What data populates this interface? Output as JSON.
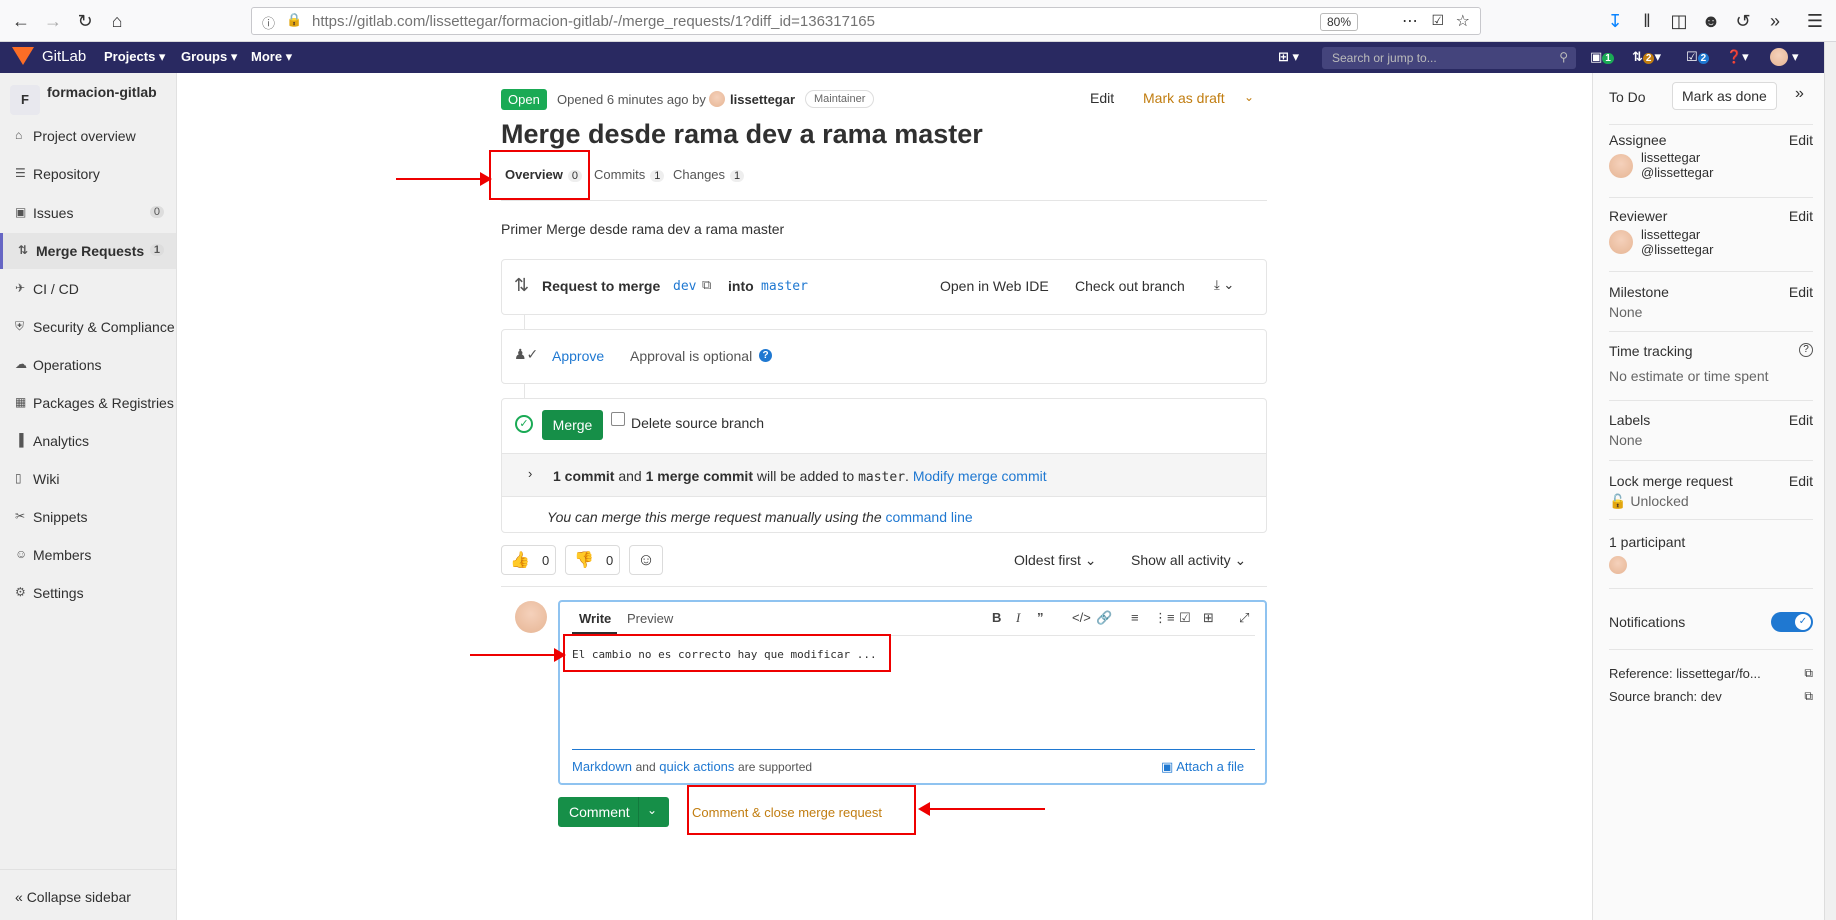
{
  "browser": {
    "url": "https://gitlab.com/lissettegar/formacion-gitlab/-/merge_requests/1?diff_id=136317165",
    "zoom": "80%"
  },
  "navbar": {
    "brand": "GitLab",
    "projects": "Projects",
    "groups": "Groups",
    "more": "More",
    "search_placeholder": "Search or jump to...",
    "badge_issues": "1",
    "badge_mr": "2",
    "badge_todo": "2"
  },
  "sidebar": {
    "project_initial": "F",
    "project_name": "formacion-gitlab",
    "items": [
      {
        "label": "Project overview",
        "icon": "home-icon"
      },
      {
        "label": "Repository",
        "icon": "doc-icon"
      },
      {
        "label": "Issues",
        "icon": "issues-icon",
        "count": "0"
      },
      {
        "label": "Merge Requests",
        "icon": "merge-icon",
        "count": "1"
      },
      {
        "label": "CI / CD",
        "icon": "rocket-icon"
      },
      {
        "label": "Security & Compliance",
        "icon": "shield-icon"
      },
      {
        "label": "Operations",
        "icon": "cloud-icon"
      },
      {
        "label": "Packages & Registries",
        "icon": "package-icon"
      },
      {
        "label": "Analytics",
        "icon": "chart-icon"
      },
      {
        "label": "Wiki",
        "icon": "book-icon"
      },
      {
        "label": "Snippets",
        "icon": "scissors-icon"
      },
      {
        "label": "Members",
        "icon": "users-icon"
      },
      {
        "label": "Settings",
        "icon": "gear-icon"
      }
    ],
    "collapse": "Collapse sidebar"
  },
  "mr": {
    "status": "Open",
    "opened": "Opened 6 minutes ago by",
    "author": "lissettegar",
    "role": "Maintainer",
    "edit": "Edit",
    "mark_draft": "Mark as draft",
    "title": "Merge desde rama dev a rama master",
    "tabs": [
      {
        "label": "Overview",
        "count": "0"
      },
      {
        "label": "Commits",
        "count": "1"
      },
      {
        "label": "Changes",
        "count": "1"
      }
    ],
    "description": "Primer Merge desde rama dev a rama master",
    "request_to_merge": "Request to merge",
    "source_branch": "dev",
    "into": "into",
    "target_branch": "master",
    "open_web_ide": "Open in Web IDE",
    "checkout": "Check out branch",
    "approve": "Approve",
    "approval_optional": "Approval is optional",
    "merge_btn": "Merge",
    "delete_source": "Delete source branch",
    "commit_line_1": "1 commit",
    "commit_line_and": "and",
    "commit_line_2": "1 merge commit",
    "commit_line_rest": "will be added to",
    "commit_target": "master",
    "modify_commit": "Modify merge commit",
    "manual_text": "You can merge this merge request manually using the",
    "command_line": "command line",
    "thumbs_up": "0",
    "thumbs_down": "0",
    "sort": "Oldest first",
    "activity": "Show all activity"
  },
  "comment": {
    "write": "Write",
    "preview": "Preview",
    "text": "El cambio no es correcto hay que modificar ...",
    "markdown": "Markdown",
    "and": "and",
    "quick_actions": "quick actions",
    "supported": "are supported",
    "attach": "Attach a file",
    "comment_btn": "Comment",
    "close_btn": "Comment & close merge request"
  },
  "right": {
    "todo": "To Do",
    "mark_done": "Mark as done",
    "assignee": "Assignee",
    "edit": "Edit",
    "assignee_name": "lissettegar",
    "assignee_user": "@lissettegar",
    "reviewer": "Reviewer",
    "reviewer_name": "lissettegar",
    "reviewer_user": "@lissettegar",
    "milestone": "Milestone",
    "milestone_val": "None",
    "time_tracking": "Time tracking",
    "time_val": "No estimate or time spent",
    "labels": "Labels",
    "labels_val": "None",
    "lock": "Lock merge request",
    "lock_val": "Unlocked",
    "participants": "1 participant",
    "notifications": "Notifications",
    "reference": "Reference: lissettegar/fo...",
    "source_branch": "Source branch: dev"
  },
  "colors": {
    "accent": "#1f78d1",
    "success": "#1aaa55",
    "navbar": "#292961",
    "warning": "#c17d10"
  }
}
